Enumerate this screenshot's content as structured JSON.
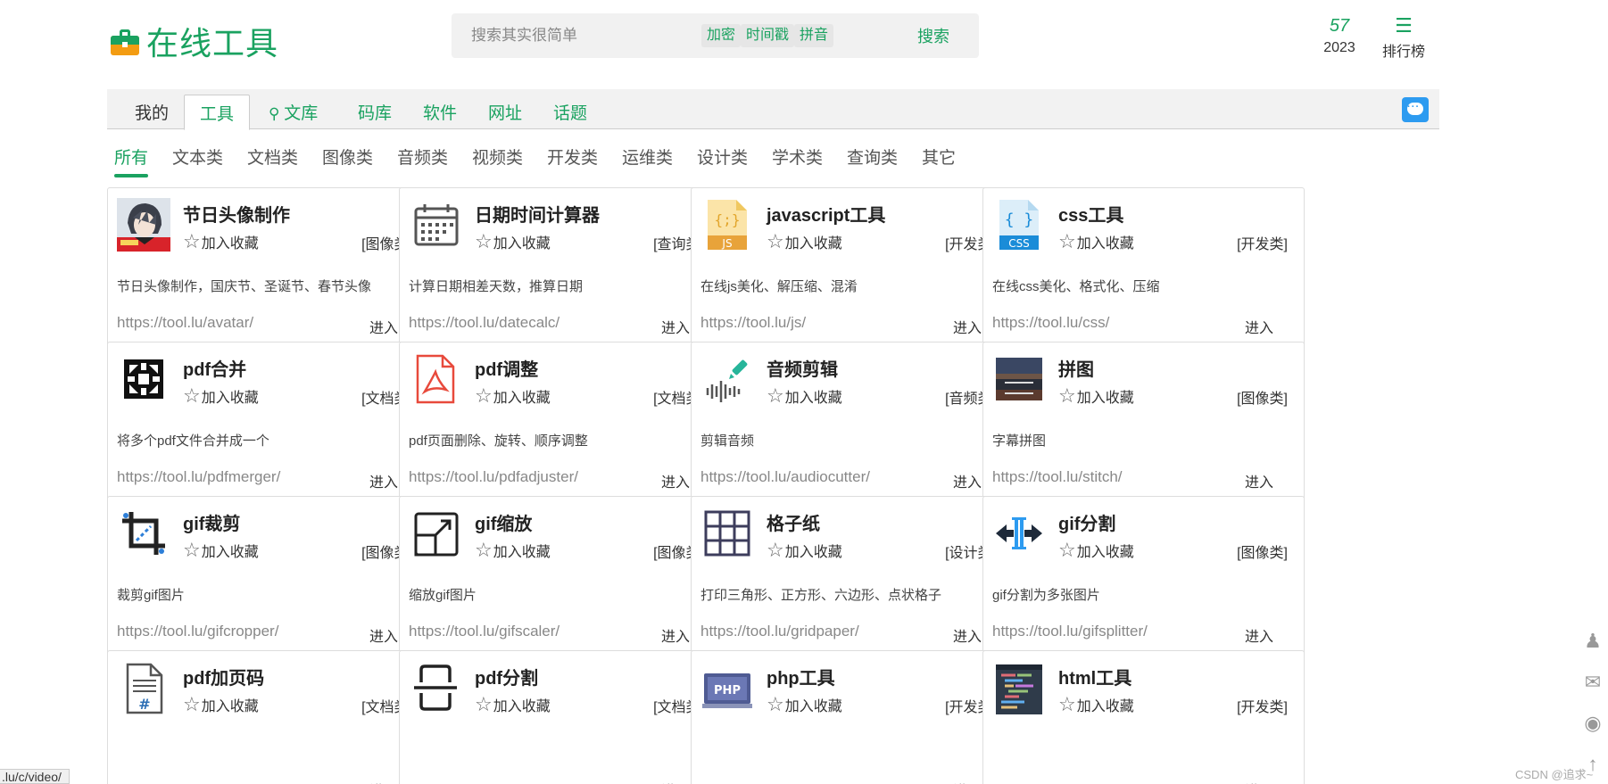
{
  "header": {
    "logo_text": "在线工具",
    "search": {
      "placeholder": "搜索其实很简单",
      "tags": [
        "加密",
        "时间戳",
        "拼音"
      ],
      "button": "搜索"
    },
    "year": {
      "value": "57",
      "label": "2023"
    },
    "rank": {
      "label": "排行榜"
    }
  },
  "nav": {
    "items": [
      "我的",
      "工具",
      "文库",
      "码库",
      "软件",
      "网址",
      "话题"
    ],
    "active": "工具"
  },
  "categories": {
    "items": [
      "所有",
      "文本类",
      "文档类",
      "图像类",
      "音频类",
      "视频类",
      "开发类",
      "运维类",
      "设计类",
      "学术类",
      "查询类",
      "其它"
    ],
    "active": "所有"
  },
  "fav_label": "加入收藏",
  "enter_label": "进入",
  "cards": [
    {
      "title": "节日头像制作",
      "category": "[图像类]",
      "desc": "节日头像制作，国庆节、圣诞节、春节头像",
      "url": "https://tool.lu/avatar/",
      "icon": "avatar-icon"
    },
    {
      "title": "日期时间计算器",
      "category": "[查询类]",
      "desc": "计算日期相差天数，推算日期",
      "url": "https://tool.lu/datecalc/",
      "icon": "calendar-icon"
    },
    {
      "title": "javascript工具",
      "category": "[开发类]",
      "desc": "在线js美化、解压缩、混淆",
      "url": "https://tool.lu/js/",
      "icon": "js-file-icon"
    },
    {
      "title": "css工具",
      "category": "[开发类]",
      "desc": "在线css美化、格式化、压缩",
      "url": "https://tool.lu/css/",
      "icon": "css-file-icon"
    },
    {
      "title": "pdf合并",
      "category": "[文档类]",
      "desc": "将多个pdf文件合并成一个",
      "url": "https://tool.lu/pdfmerger/",
      "icon": "merge-icon"
    },
    {
      "title": "pdf调整",
      "category": "[文档类]",
      "desc": "pdf页面删除、旋转、顺序调整",
      "url": "https://tool.lu/pdfadjuster/",
      "icon": "pdf-icon"
    },
    {
      "title": "音频剪辑",
      "category": "[音频类]",
      "desc": "剪辑音频",
      "url": "https://tool.lu/audiocutter/",
      "icon": "audio-wave-icon"
    },
    {
      "title": "拼图",
      "category": "[图像类]",
      "desc": "字幕拼图",
      "url": "https://tool.lu/stitch/",
      "icon": "photo-stitch-icon"
    },
    {
      "title": "gif裁剪",
      "category": "[图像类]",
      "desc": "裁剪gif图片",
      "url": "https://tool.lu/gifcropper/",
      "icon": "crop-icon"
    },
    {
      "title": "gif缩放",
      "category": "[图像类]",
      "desc": "缩放gif图片",
      "url": "https://tool.lu/gifscaler/",
      "icon": "scale-icon"
    },
    {
      "title": "格子纸",
      "category": "[设计类]",
      "desc": "打印三角形、正方形、六边形、点状格子",
      "url": "https://tool.lu/gridpaper/",
      "icon": "grid-icon"
    },
    {
      "title": "gif分割",
      "category": "[图像类]",
      "desc": "gif分割为多张图片",
      "url": "https://tool.lu/gifsplitter/",
      "icon": "split-icon"
    },
    {
      "title": "pdf加页码",
      "category": "[文档类]",
      "desc": "",
      "url": "",
      "icon": "page-number-icon"
    },
    {
      "title": "pdf分割",
      "category": "[文档类]",
      "desc": "",
      "url": "",
      "icon": "pdf-split-icon"
    },
    {
      "title": "php工具",
      "category": "[开发类]",
      "desc": "",
      "url": "",
      "icon": "php-icon"
    },
    {
      "title": "html工具",
      "category": "[开发类]",
      "desc": "",
      "url": "",
      "icon": "html-code-icon"
    }
  ],
  "status_bar": ".lu/c/video/",
  "watermark": "CSDN @追求~",
  "colors": {
    "accent": "#1aa260",
    "chat": "#2d9bf0"
  }
}
